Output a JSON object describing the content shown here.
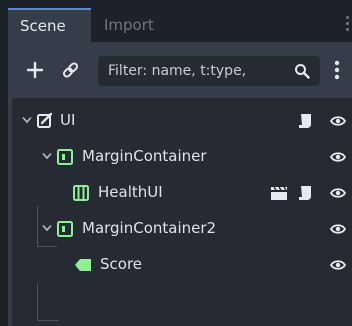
{
  "tabs": [
    {
      "label": "Scene",
      "active": true
    },
    {
      "label": "Import",
      "active": false
    }
  ],
  "toolbar": {
    "add_icon": "plus-icon",
    "link_icon": "chain-link-icon",
    "filter_placeholder": "Filter: name, t:type,",
    "search_icon": "magnifier-icon",
    "menu_icon": "vertical-dots-icon"
  },
  "tree": {
    "nodes": [
      {
        "name": "UI",
        "icon": "control-node-icon",
        "expanded": true,
        "badges": [
          "script-icon"
        ],
        "visible": true
      },
      {
        "name": "MarginContainer",
        "icon": "margin-container-icon",
        "expanded": true,
        "badges": [],
        "visible": true
      },
      {
        "name": "HealthUI",
        "icon": "hbox-container-icon",
        "expanded": false,
        "badges": [
          "instance-scene-icon",
          "script-icon"
        ],
        "visible": true
      },
      {
        "name": "MarginContainer2",
        "icon": "margin-container-icon",
        "expanded": true,
        "badges": [],
        "visible": true
      },
      {
        "name": "Score",
        "icon": "label-node-icon",
        "expanded": false,
        "badges": [],
        "visible": true
      }
    ]
  },
  "colors": {
    "accent": "#5a8bd8",
    "container_green": "#8eef97",
    "panel_bg": "#363d4a",
    "tree_bg": "#262b33"
  }
}
